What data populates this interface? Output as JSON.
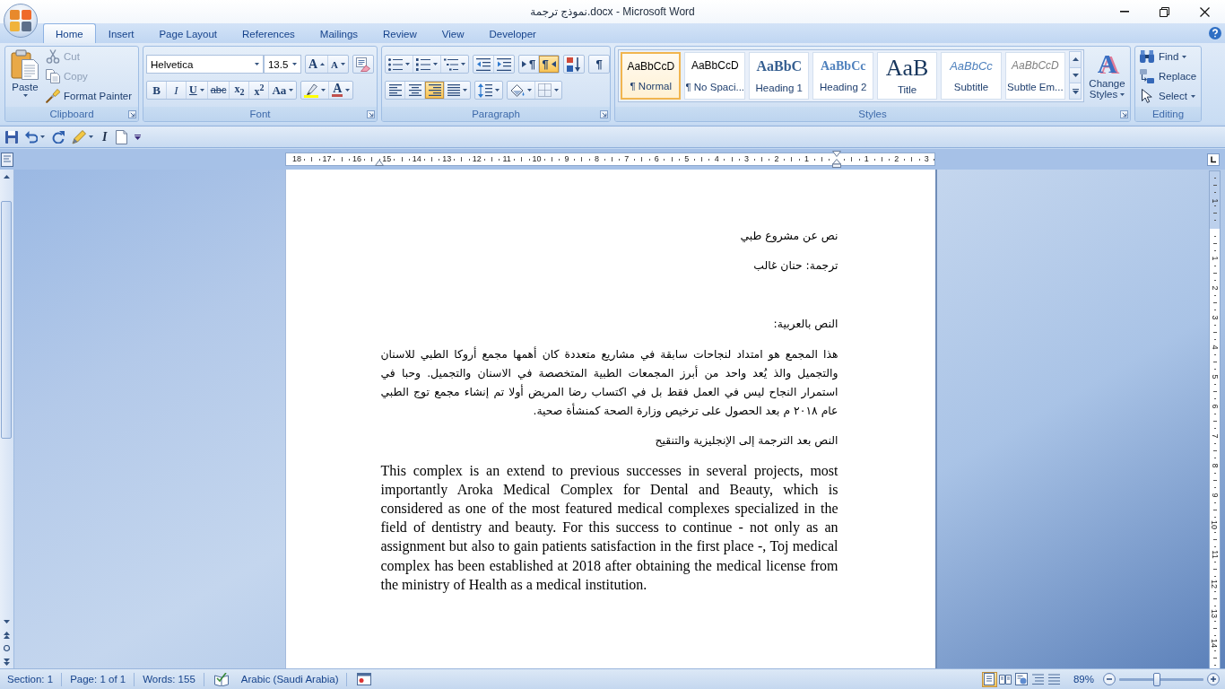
{
  "window": {
    "title": "نموذج ترجمة.docx - Microsoft Word"
  },
  "ribbon_tabs": [
    {
      "label": "Home",
      "selected": true
    },
    {
      "label": "Insert",
      "selected": false
    },
    {
      "label": "Page Layout",
      "selected": false
    },
    {
      "label": "References",
      "selected": false
    },
    {
      "label": "Mailings",
      "selected": false
    },
    {
      "label": "Review",
      "selected": false
    },
    {
      "label": "View",
      "selected": false
    },
    {
      "label": "Developer",
      "selected": false
    }
  ],
  "ribbon": {
    "clipboard": {
      "label": "Clipboard",
      "launcher": true,
      "paste": {
        "label": "Paste",
        "dropdown": true
      },
      "items": [
        {
          "kind": "cut",
          "label": "Cut",
          "disabled": true
        },
        {
          "kind": "copy",
          "label": "Copy",
          "disabled": true
        },
        {
          "kind": "painter",
          "label": "Format Painter",
          "disabled": false
        }
      ]
    },
    "font": {
      "label": "Font",
      "launcher": true,
      "font_name": "Helvetica",
      "font_size": "13.5",
      "rows": [
        [
          [
            {
              "kind": "grow",
              "text": "A",
              "dropdown": false
            },
            {
              "kind": "shrink",
              "text": "A",
              "dropdown": false
            }
          ],
          [
            {
              "kind": "clear",
              "dropdown": false
            }
          ]
        ],
        [
          [
            {
              "kind": "bold",
              "text": "B",
              "dropdown": false
            },
            {
              "kind": "italic",
              "text": "I",
              "dropdown": false
            },
            {
              "kind": "underline",
              "text": "U",
              "dropdown": true
            },
            {
              "kind": "strike",
              "text": "abc",
              "dropdown": false
            },
            {
              "kind": "subscript",
              "text": "x$_{2}$",
              "dropdown": false
            },
            {
              "kind": "superscript",
              "text": "x$^{2}$",
              "dropdown": false
            },
            {
              "kind": "case",
              "text": "Aa",
              "dropdown": true
            }
          ],
          [
            {
              "kind": "highlight",
              "dropdown": true
            },
            {
              "kind": "font_color",
              "text": "A",
              "dropdown": true
            }
          ]
        ]
      ]
    },
    "paragraph": {
      "label": "Paragraph",
      "launcher": true,
      "rows": [
        [
          [
            {
              "kind": "bullets",
              "dropdown": true,
              "selected": false
            },
            {
              "kind": "numbering",
              "dropdown": true,
              "selected": false
            },
            {
              "kind": "multilevel",
              "dropdown": true,
              "selected": false
            }
          ],
          [
            {
              "kind": "outdent",
              "dropdown": false,
              "selected": false
            },
            {
              "kind": "indent",
              "dropdown": false,
              "selected": false
            }
          ],
          [
            {
              "kind": "ltr",
              "text": "¶",
              "dropdown": false,
              "selected": false
            },
            {
              "kind": "rtl",
              "text": "¶",
              "dropdown": false,
              "selected": true
            }
          ],
          [
            {
              "kind": "sort",
              "dropdown": false,
              "selected": false
            }
          ],
          [
            {
              "kind": "show_marks",
              "text": "¶",
              "dropdown": false,
              "selected": false
            }
          ]
        ],
        [
          [
            {
              "kind": "align_left",
              "dropdown": false,
              "selected": false
            },
            {
              "kind": "center",
              "dropdown": false,
              "selected": false
            },
            {
              "kind": "align_right",
              "dropdown": false,
              "selected": true
            },
            {
              "kind": "justify",
              "dropdown": true,
              "selected": false
            }
          ],
          [
            {
              "kind": "line_spacing",
              "dropdown": true,
              "selected": false
            }
          ],
          [
            {
              "kind": "shading",
              "dropdown": true,
              "selected": false
            },
            {
              "kind": "borders",
              "dropdown": true,
              "selected": false
            }
          ]
        ]
      ]
    },
    "styles": {
      "label": "Styles",
      "launcher": true,
      "items": [
        {
          "kind": "normal",
          "preview": "AaBbCcD",
          "label": "¶ Normal",
          "selected": true
        },
        {
          "kind": "no_spacing",
          "preview": "AaBbCcD",
          "label": "¶ No Spaci...",
          "selected": false
        },
        {
          "kind": "heading1",
          "preview": "AaBbC",
          "label": "Heading 1",
          "selected": false
        },
        {
          "kind": "heading2",
          "preview": "AaBbCc",
          "label": "Heading 2",
          "selected": false
        },
        {
          "kind": "title",
          "preview": "AaB",
          "label": "Title",
          "selected": false
        },
        {
          "kind": "subtitle",
          "preview": "AaBbCc",
          "label": "Subtitle",
          "selected": false
        },
        {
          "kind": "subtle_emphasis",
          "preview": "AaBbCcD",
          "label": "Subtle Em...",
          "selected": false
        }
      ],
      "change_styles": {
        "glyph": "A",
        "label": "Change Styles",
        "dropdown": true
      }
    },
    "editing": {
      "label": "Editing",
      "launcher": false,
      "items": [
        {
          "kind": "find",
          "label": "Find",
          "dropdown": true
        },
        {
          "kind": "replace",
          "label": "Replace",
          "dropdown": false
        },
        {
          "kind": "select",
          "label": "Select",
          "dropdown": true
        }
      ]
    }
  },
  "quick_access": [
    {
      "kind": "save",
      "dropdown": false
    },
    {
      "kind": "undo",
      "dropdown": true
    },
    {
      "kind": "redo",
      "dropdown": false
    },
    {
      "kind": "repeat",
      "dropdown": true
    },
    {
      "kind": "italic",
      "text": "I",
      "dropdown": false
    },
    {
      "kind": "new",
      "dropdown": false
    },
    {
      "kind": "customize",
      "dropdown": false
    }
  ],
  "ruler": {
    "left_numbers": [
      "18",
      "17",
      "16",
      "15",
      "14",
      "13",
      "12",
      "11",
      "10",
      "9",
      "8",
      "7",
      "6",
      "5",
      "4",
      "3",
      "2",
      "1"
    ],
    "right_numbers": [
      "1",
      "2",
      "3"
    ]
  },
  "vertical_ruler": {
    "top_numbers": [
      "1"
    ],
    "numbers": [
      "1",
      "2",
      "3",
      "4",
      "5",
      "6",
      "7",
      "8",
      "9",
      "10",
      "11",
      "12",
      "13",
      "14"
    ]
  },
  "document": {
    "paragraphs": [
      {
        "kind": "line",
        "rtl": true,
        "text": "نص عن مشروع طبي"
      },
      {
        "kind": "line",
        "rtl": true,
        "text": "ترجمة: حنان غالب"
      },
      {
        "kind": "heading",
        "rtl": true,
        "text": "النص بالعربية:"
      },
      {
        "kind": "body",
        "rtl": true,
        "text": "هذا المجمع هو امتداد لنجاحات سابقة في مشاريع متعددة كان أهمها مجمع أروكا الطبي للاسنان والتجميل والذ يُعد واحد من أبرز المجمعات الطبية المتخصصة في الاسنان والتجميل. وحبا في استمرار النجاح ليس في العمل فقط بل في اكتساب رضا المريض أولا تم إنشاء مجمع توج الطبي عام ٢٠١٨ م بعد الحصول على ترخيص وزارة الصحة كمنشأة صحية."
      },
      {
        "kind": "line",
        "rtl": true,
        "text": "النص بعد الترجمة إلى الإنجليزية والتنقيح"
      },
      {
        "kind": "body",
        "rtl": false,
        "text": "This complex is an extend to previous successes in several projects, most importantly Aroka Medical Complex for Dental and Beauty, which is considered as one of the most featured medical complexes specialized in the field of dentistry and beauty. For this success to continue - not only as an assignment but also to gain patients satisfaction in the first place -, Toj medical complex has been established at 2018 after obtaining the medical license from the ministry of Health as a medical institution."
      }
    ]
  },
  "status_bar": {
    "fields": [
      {
        "kind": "text",
        "text": "Section: 1"
      },
      {
        "kind": "text",
        "text": "Page: 1 of 1"
      },
      {
        "kind": "text",
        "text": "Words: 155"
      },
      {
        "kind": "spelling"
      },
      {
        "kind": "text",
        "text": "Arabic (Saudi Arabia)"
      },
      {
        "kind": "macro"
      }
    ],
    "views": [
      {
        "kind": "print_layout",
        "selected": true
      },
      {
        "kind": "full_reading",
        "selected": false
      },
      {
        "kind": "web_layout",
        "selected": false
      },
      {
        "kind": "outline",
        "selected": false
      },
      {
        "kind": "draft",
        "selected": false
      }
    ],
    "zoom": {
      "text": "89%",
      "level": 0.45
    }
  }
}
